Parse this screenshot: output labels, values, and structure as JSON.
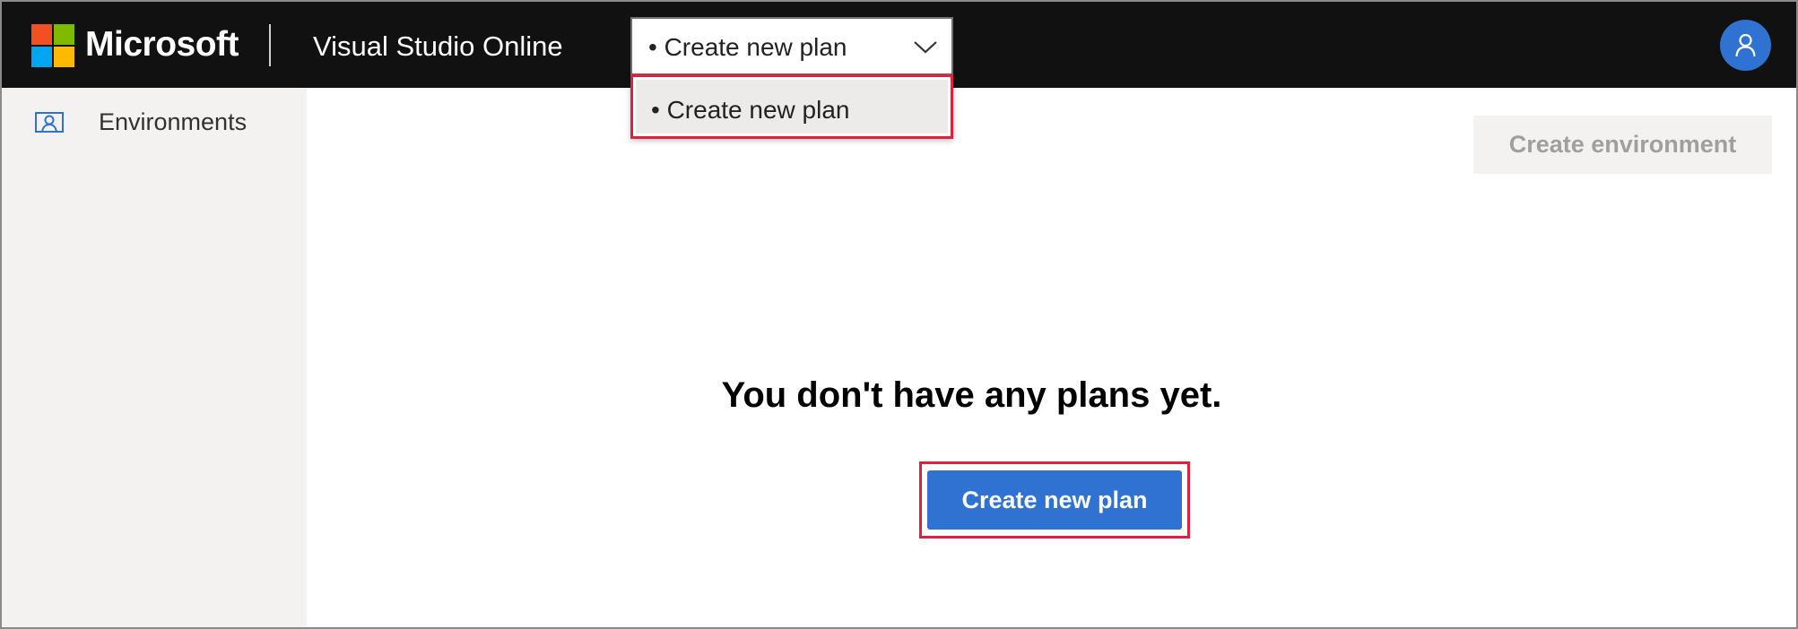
{
  "header": {
    "brand": "Microsoft",
    "product": "Visual Studio Online",
    "plan_selector": {
      "value": "• Create new plan"
    },
    "avatar_icon": "user-icon"
  },
  "dropdown": {
    "options": [
      {
        "label": "• Create new plan"
      }
    ]
  },
  "sidebar": {
    "items": [
      {
        "label": "Environments",
        "icon": "environment-icon"
      }
    ]
  },
  "main": {
    "create_environment_label": "Create environment",
    "empty_message": "You don't have any plans yet.",
    "create_plan_label": "Create new plan"
  },
  "colors": {
    "topbar": "#111111",
    "accent": "#2f72d2",
    "highlight": "#e0213e",
    "sidebar": "#f3f2f1"
  }
}
